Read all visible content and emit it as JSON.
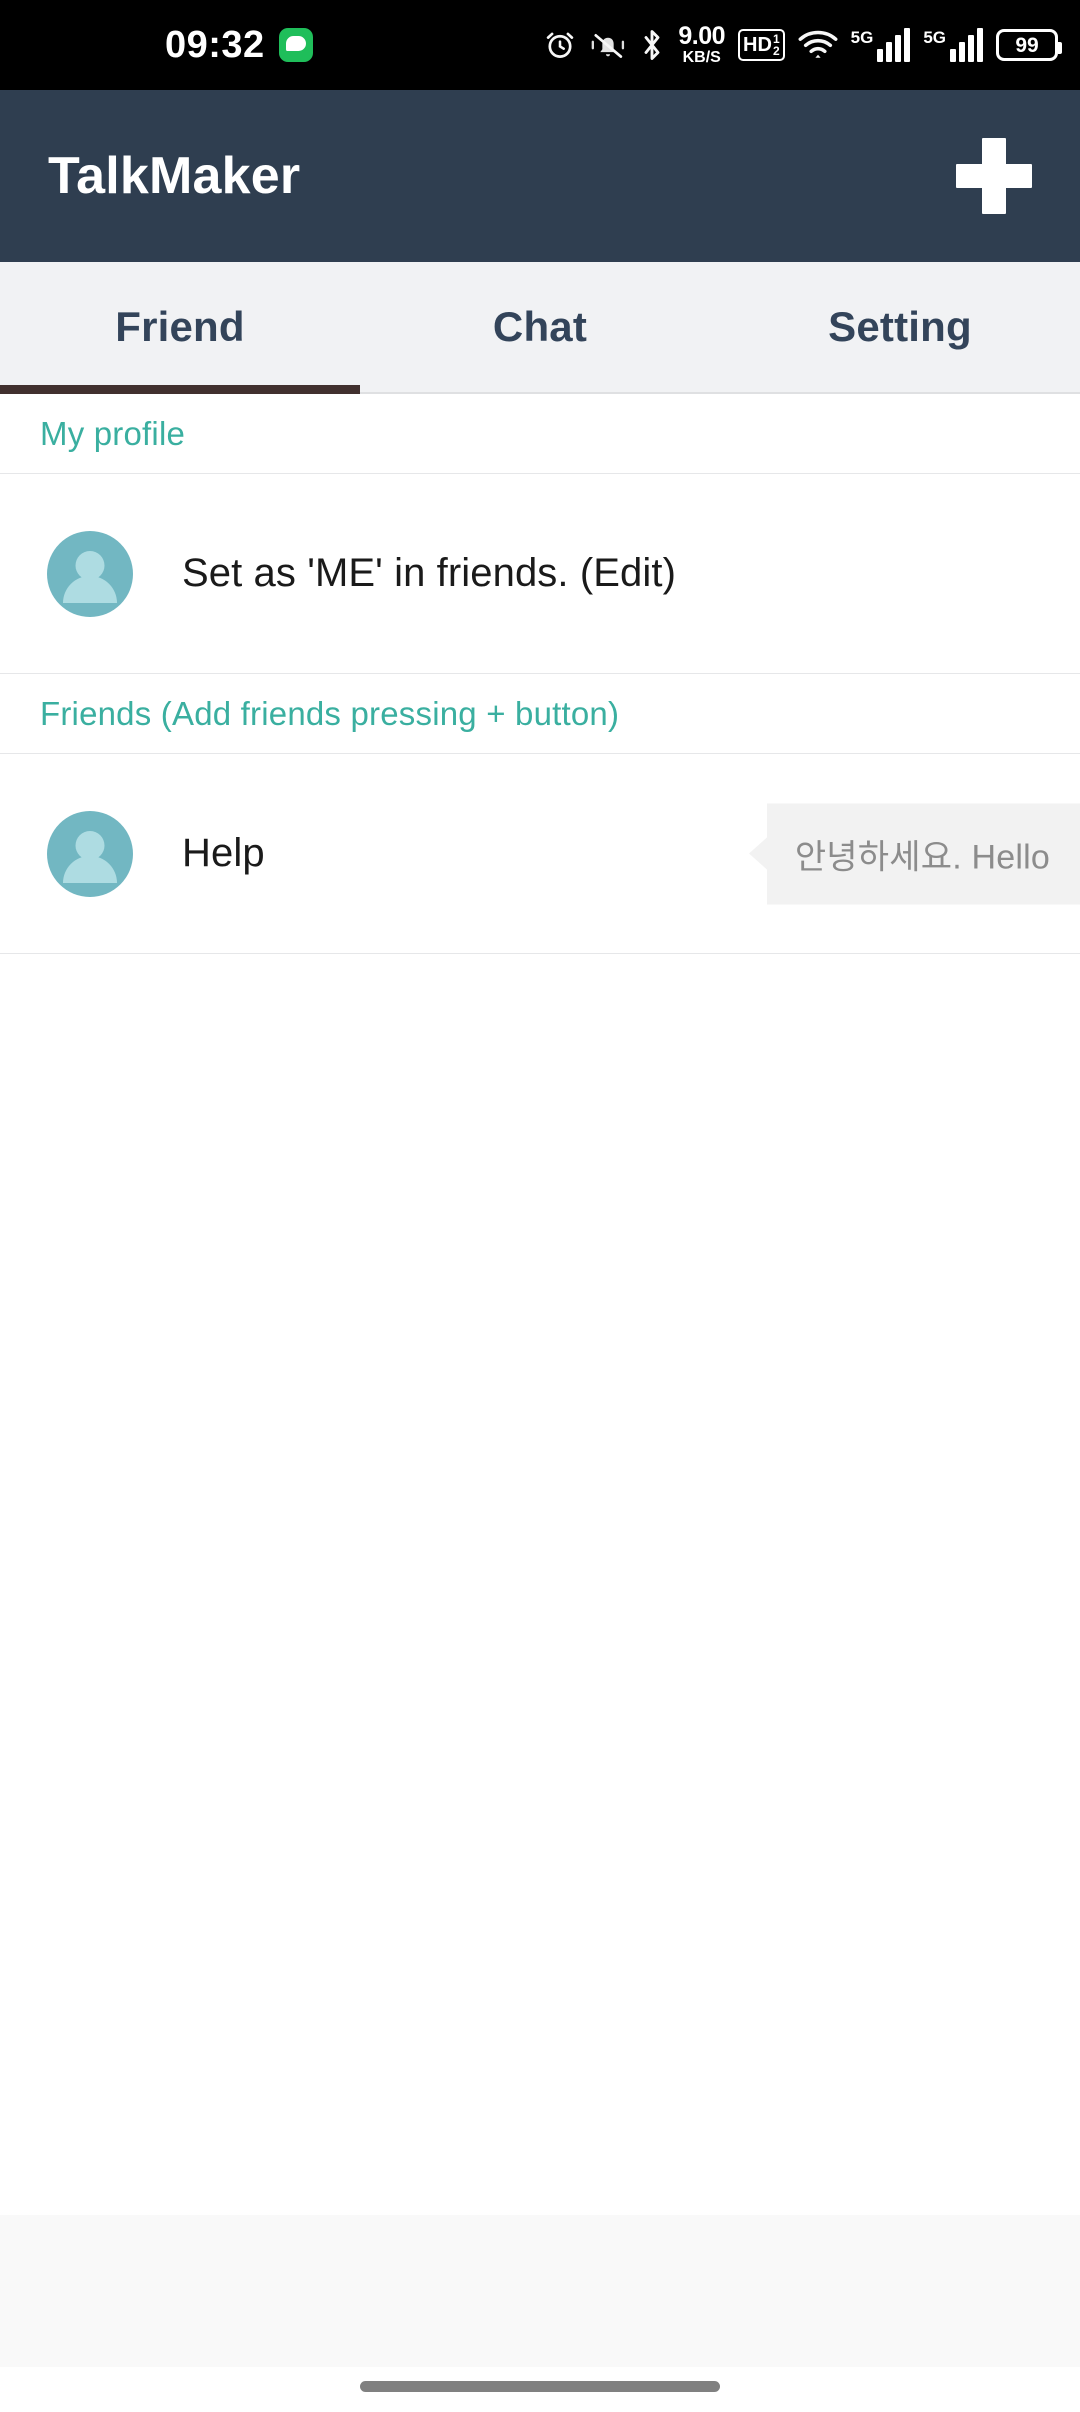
{
  "status_bar": {
    "time": "09:32",
    "messenger_icon": "kakaotalk-badge-icon",
    "icons": [
      "alarm-icon",
      "vibrate-mute-icon",
      "bluetooth-icon"
    ],
    "network_speed_value": "9.00",
    "network_speed_unit": "KB/S",
    "hd_label": "HD",
    "hd_sup": "1",
    "hd_sub": "2",
    "wifi_icon": "wifi-icon",
    "sim1_network": "5G",
    "sim2_network": "5G",
    "battery_level": "99"
  },
  "app_bar": {
    "title": "TalkMaker",
    "add_button_label": "+",
    "background_color": "#2F3E50"
  },
  "tabs": {
    "items": [
      {
        "label": "Friend",
        "active": true
      },
      {
        "label": "Chat",
        "active": false
      },
      {
        "label": "Setting",
        "active": false
      }
    ],
    "indicator_color": "#41302E",
    "background_color": "#F1F2F4",
    "text_color": "#33445A"
  },
  "sections": [
    {
      "header": "My profile",
      "header_color": "#3AAFA0",
      "rows": [
        {
          "avatar": "person-placeholder-avatar",
          "name": "Set as 'ME' in friends. (Edit)",
          "bubble": null
        }
      ]
    },
    {
      "header": "Friends (Add friends pressing + button)",
      "header_color": "#3AAFA0",
      "rows": [
        {
          "avatar": "person-placeholder-avatar",
          "name": "Help",
          "bubble": "안녕하세요. Hello"
        }
      ]
    }
  ],
  "bottom": {
    "ad_slot_color": "#F9F9F9",
    "nav_pill_color": "#808080"
  }
}
